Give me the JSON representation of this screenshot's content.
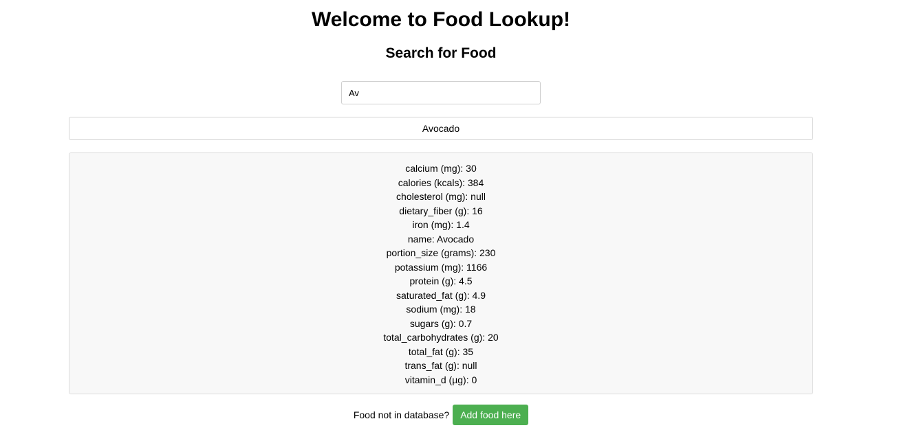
{
  "header": {
    "title": "Welcome to Food Lookup!",
    "subtitle": "Search for Food"
  },
  "search": {
    "value": "Av",
    "placeholder": ""
  },
  "suggestion": {
    "label": "Avocado"
  },
  "details": {
    "lines": [
      "calcium (mg): 30",
      "calories (kcals): 384",
      "cholesterol (mg): null",
      "dietary_fiber (g): 16",
      "iron (mg): 1.4",
      "name: Avocado",
      "portion_size (grams): 230",
      "potassium (mg): 1166",
      "protein (g): 4.5",
      "saturated_fat (g): 4.9",
      "sodium (mg): 18",
      "sugars (g): 0.7",
      "total_carbohydrates (g): 20",
      "total_fat (g): 35",
      "trans_fat (g): null",
      "vitamin_d (µg): 0"
    ]
  },
  "footer": {
    "prompt": "Food not in database?",
    "button_label": "Add food here"
  },
  "colors": {
    "button_bg": "#4caf50",
    "details_bg": "#f8f8f8"
  }
}
